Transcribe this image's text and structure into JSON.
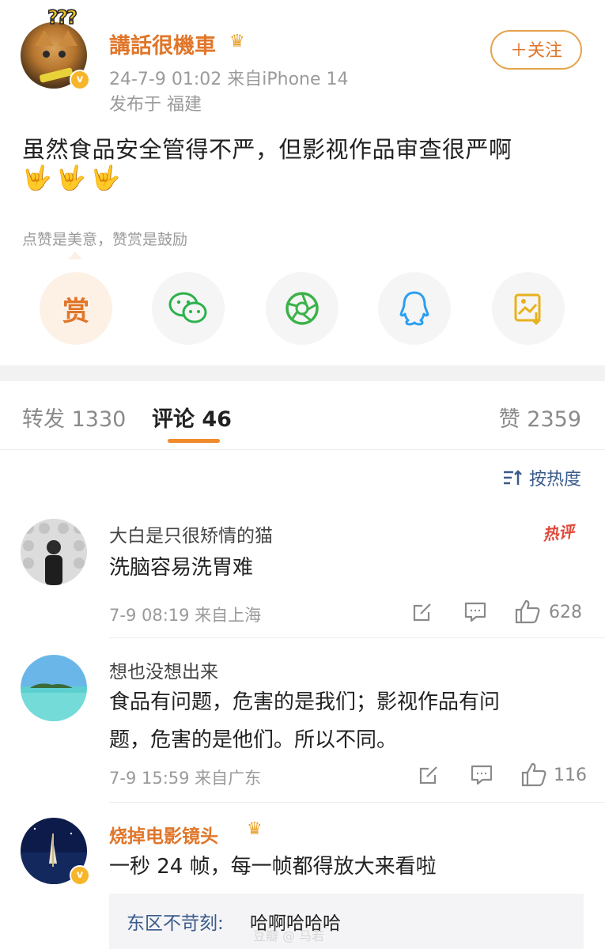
{
  "post": {
    "username": "講話很機車",
    "time_device": "24-7-9 01:02  来自iPhone 14",
    "location": "发布于 福建",
    "follow_label": "＋关注",
    "text": "虽然食品安全管得不严，但影视作品审查很严啊",
    "emoji": "🤟🤟🤟",
    "reward_hint": "点赞是美意，赞赏是鼓励",
    "reward_label": "赏"
  },
  "tabs": {
    "repost": "转发 1330",
    "comment": "评论 46",
    "like": "赞 2359"
  },
  "sort_label": "按热度",
  "comments": [
    {
      "name": "大白是只很矫情的猫",
      "badge": "热评",
      "text": "洗脑容易洗胃难",
      "meta": "7-9 08:19  来自上海",
      "likes": "628"
    },
    {
      "name": "想也没想出来",
      "text_line1": "食品有问题，危害的是我们；影视作品有问",
      "text_line2": "题，危害的是他们。所以不同。",
      "meta": "7-9 15:59  来自广东",
      "likes": "116"
    },
    {
      "name": "烧掉电影镜头",
      "text": "一秒 24 帧，每一帧都得放大来看啦",
      "reply_user": "东区不苛刻:",
      "reply_text": "哈啊哈哈哈"
    }
  ],
  "watermark": "豆瓣 @ 马若",
  "colors": {
    "accent_orange": "#e0762a",
    "link_blue": "#3a5a8a",
    "hot_red": "#e04a3a"
  }
}
